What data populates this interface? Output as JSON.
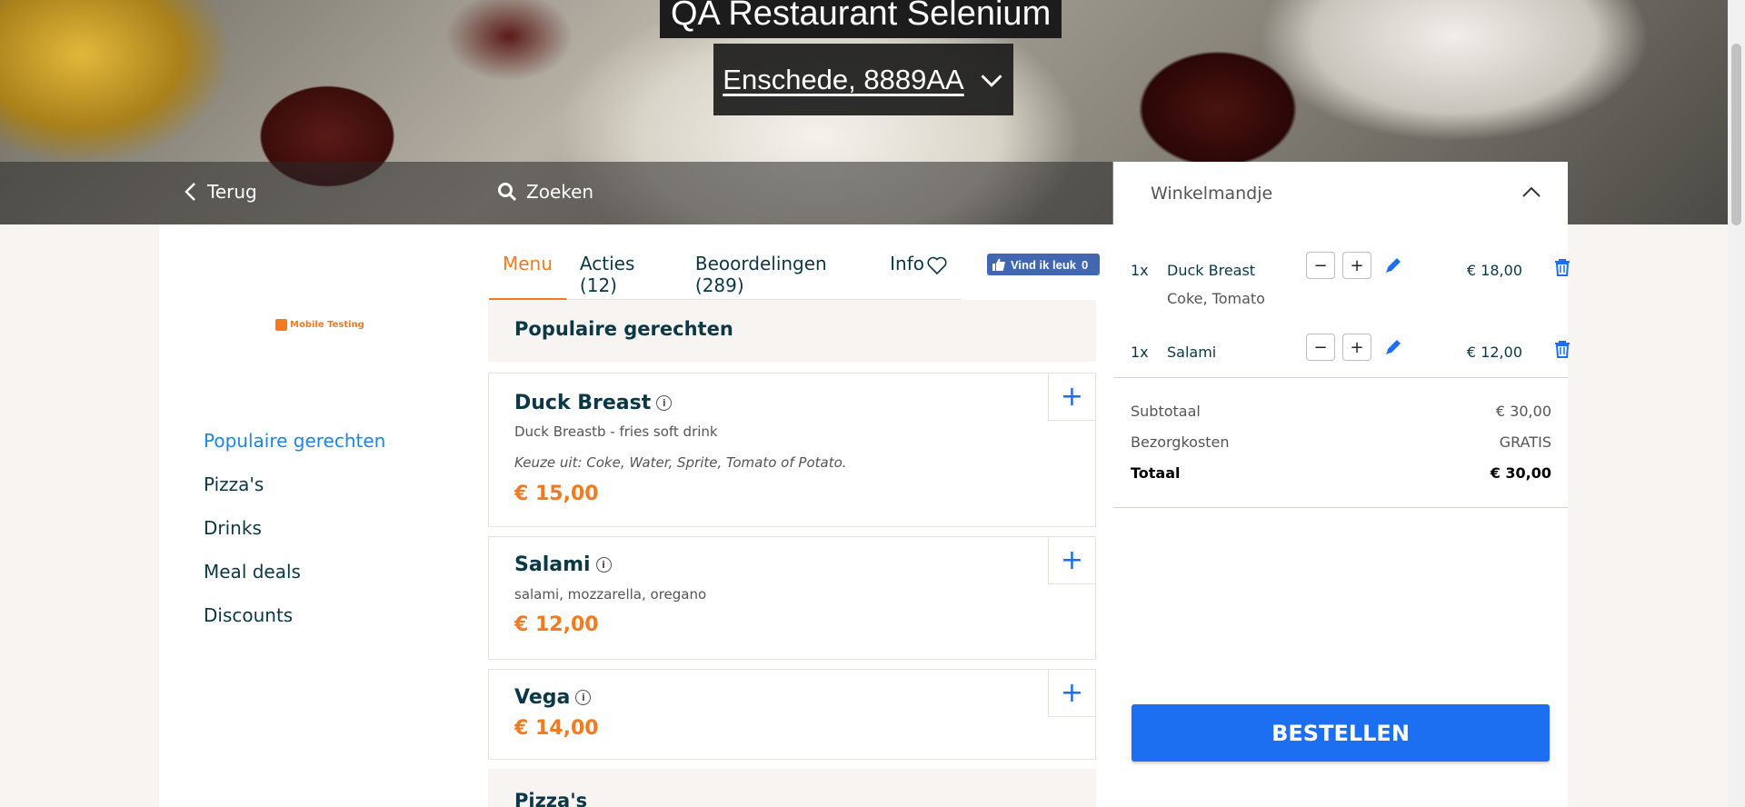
{
  "hero": {
    "restaurant_name": "QA Restaurant Selenium",
    "location": "Enschede, 8889AA",
    "back_label": "Terug",
    "search_label": "Zoeken"
  },
  "logo": {
    "text": "Mobile Testing"
  },
  "categories": [
    "Populaire gerechten",
    "Pizza's",
    "Drinks",
    "Meal deals",
    "Discounts"
  ],
  "tabs": {
    "menu": "Menu",
    "actions": "Acties (12)",
    "reviews": "Beoordelingen (289)",
    "info": "Info",
    "like_label": "Vind ik leuk",
    "like_count": "0"
  },
  "sections": {
    "popular": "Populaire gerechten",
    "pizzas": "Pizza's"
  },
  "products": [
    {
      "name": "Duck Breast",
      "description": "Duck Breastb - fries soft drink",
      "choice": "Keuze uit: Coke, Water, Sprite, Tomato of Potato.",
      "price": "€ 15,00"
    },
    {
      "name": "Salami",
      "description": "salami, mozzarella, oregano",
      "price": "€ 12,00"
    },
    {
      "name": "Vega",
      "price": "€ 14,00"
    }
  ],
  "basket": {
    "title": "Winkelmandje",
    "items": [
      {
        "qty": "1x",
        "name": "Duck Breast",
        "extras": "Coke, Tomato",
        "price": "€ 18,00"
      },
      {
        "qty": "1x",
        "name": "Salami",
        "price": "€ 12,00"
      }
    ],
    "subtotal_label": "Subtotaal",
    "subtotal": "€ 30,00",
    "delivery_label": "Bezorgkosten",
    "delivery": "GRATIS",
    "total_label": "Totaal",
    "total": "€ 30,00",
    "order_button": "BESTELLEN"
  },
  "colors": {
    "accent_orange": "#f47a20",
    "accent_blue": "#1c6ff0",
    "text_dark": "#0a3847"
  }
}
